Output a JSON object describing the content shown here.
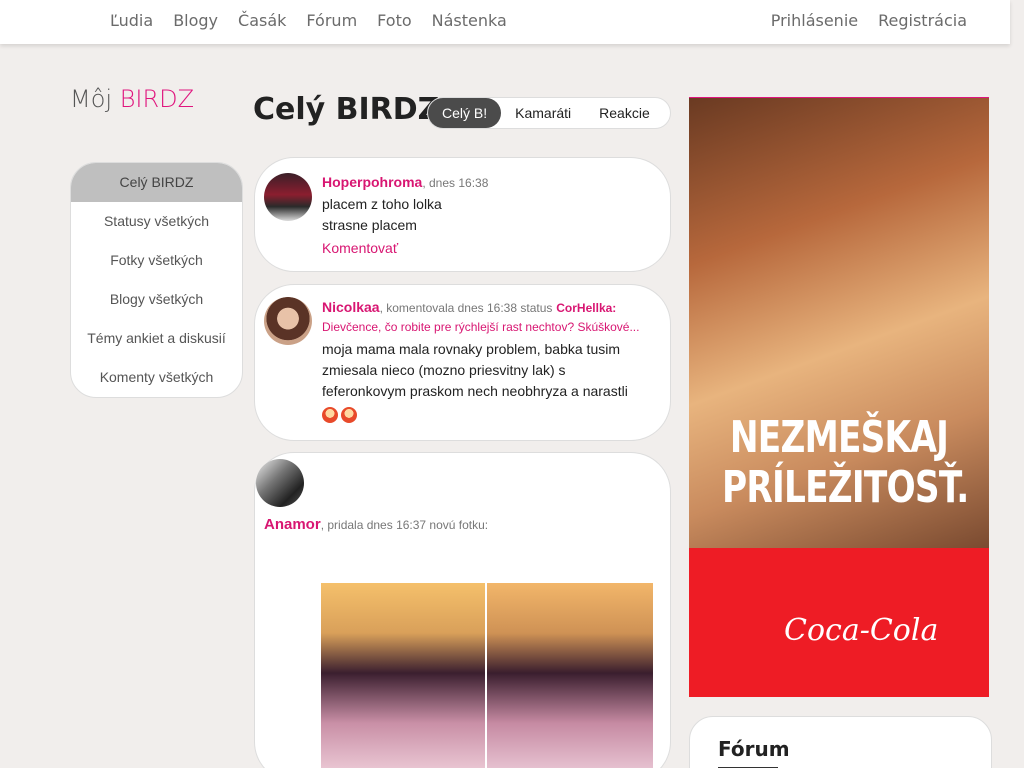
{
  "nav": {
    "left": [
      "Ľudia",
      "Blogy",
      "Časák",
      "Fórum",
      "Foto",
      "Nástenka"
    ],
    "login": "Prihlásenie",
    "register": "Registrácia"
  },
  "sidebar": {
    "title_prefix": "Môj",
    "title_accent": "BIRDZ",
    "items": [
      "Celý BIRDZ",
      "Statusy všetkých",
      "Fotky všetkých",
      "Blogy všetkých",
      "Témy ankiet a diskusií",
      "Komenty všetkých"
    ],
    "active_index": 0
  },
  "main": {
    "title": "Celý BIRDZ",
    "tabs": [
      "Celý B!",
      "Kamaráti",
      "Reakcie"
    ],
    "active_tab": 0
  },
  "posts": [
    {
      "user": "Hoperpohroma",
      "meta": ", dnes 16:38",
      "lines": [
        "placem z toho lolka",
        "strasne placem"
      ],
      "action": "Komentovať"
    },
    {
      "user": "Nicolkaa",
      "meta": ", komentovala dnes 16:38 status",
      "target_user": "CorHellka:",
      "target_text": "Dievčence, čo robite pre rýchlejší rast nechtov? Skúškové...",
      "text": "moja mama mala rovnaky problem, babka tusim zmiesala nieco (mozno priesvitny lak) s feferonkovym praskom nech neobhryza a narastli"
    },
    {
      "user": "Anamor",
      "meta": ", pridala dnes 16:37 novú fotku:"
    }
  ],
  "ad": {
    "headline_1": "NEZMEŠKAJ",
    "headline_2": "PRÍLEŽITOSŤ.",
    "brand": "Coca-Cola"
  },
  "forum": {
    "title": "Fórum"
  },
  "colors": {
    "accent": "#e0157e",
    "link": "#d81672",
    "background": "#f1eeec",
    "ad_red": "#ee1c25"
  }
}
